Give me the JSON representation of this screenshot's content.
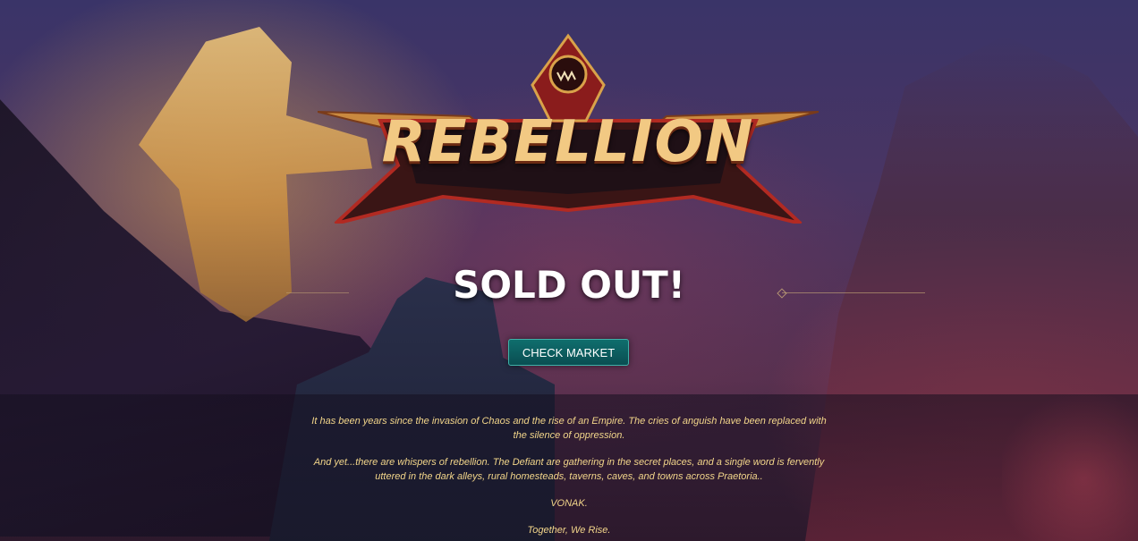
{
  "logo": {
    "text": "REBELLION"
  },
  "status": {
    "headline": "SOLD OUT!"
  },
  "actions": {
    "check_market_label": "CHECK MARKET"
  },
  "story": {
    "paragraph_1": "It has been years since the invasion of Chaos and the rise of an Empire. The cries of anguish have been replaced with the silence of oppression.",
    "paragraph_2": "And yet...there are whispers of rebellion. The Defiant are gathering in the secret places, and a single word is fervently uttered in the dark alleys, rural homesteads, taverns, caves, and towns across Praetoria..",
    "paragraph_3": "VONAK.",
    "paragraph_4": "Together, We Rise."
  },
  "colors": {
    "button_bg": "#0f6e6d",
    "button_border": "#3fb1a8",
    "story_text": "#f2d58a",
    "logo_text": "#f2c983"
  }
}
